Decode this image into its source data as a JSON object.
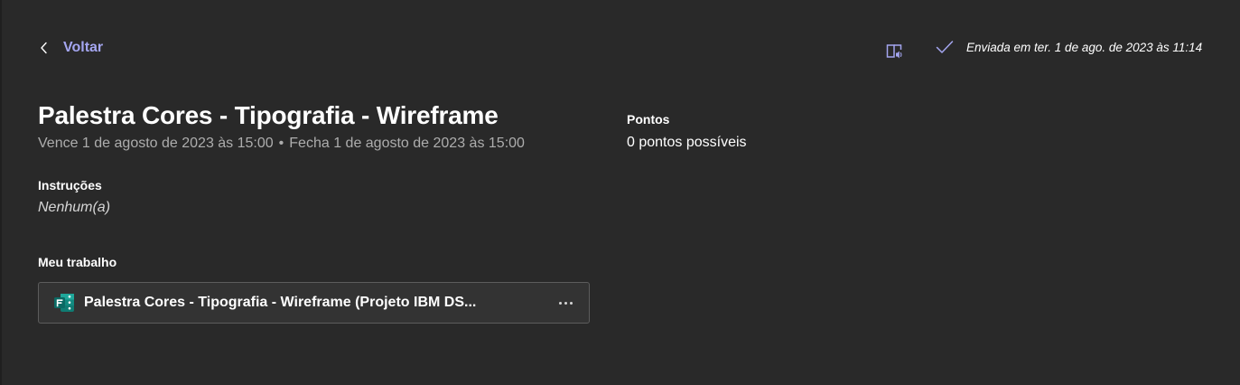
{
  "nav": {
    "back_label": "Voltar"
  },
  "header": {
    "status_text": "Enviada em ter. 1 de ago. de 2023 às 11:14"
  },
  "assignment": {
    "title": "Palestra Cores - Tipografia - Wireframe",
    "due": "Vence 1 de agosto de 2023 às 15:00",
    "separator": "•",
    "closes": "Fecha 1 de agosto de 2023 às 15:00"
  },
  "instructions": {
    "label": "Instruções",
    "value": "Nenhum(a)"
  },
  "points": {
    "label": "Pontos",
    "value": "0 pontos possíveis"
  },
  "my_work": {
    "label": "Meu trabalho",
    "attachments": [
      {
        "icon": "microsoft-forms-icon",
        "name": "Palestra Cores - Tipografia - Wireframe (Projeto IBM DS..."
      }
    ]
  },
  "colors": {
    "background": "#292929",
    "accent": "#a4a6f0",
    "muted_text": "#adadad",
    "forms_green": "#0b7a75"
  }
}
